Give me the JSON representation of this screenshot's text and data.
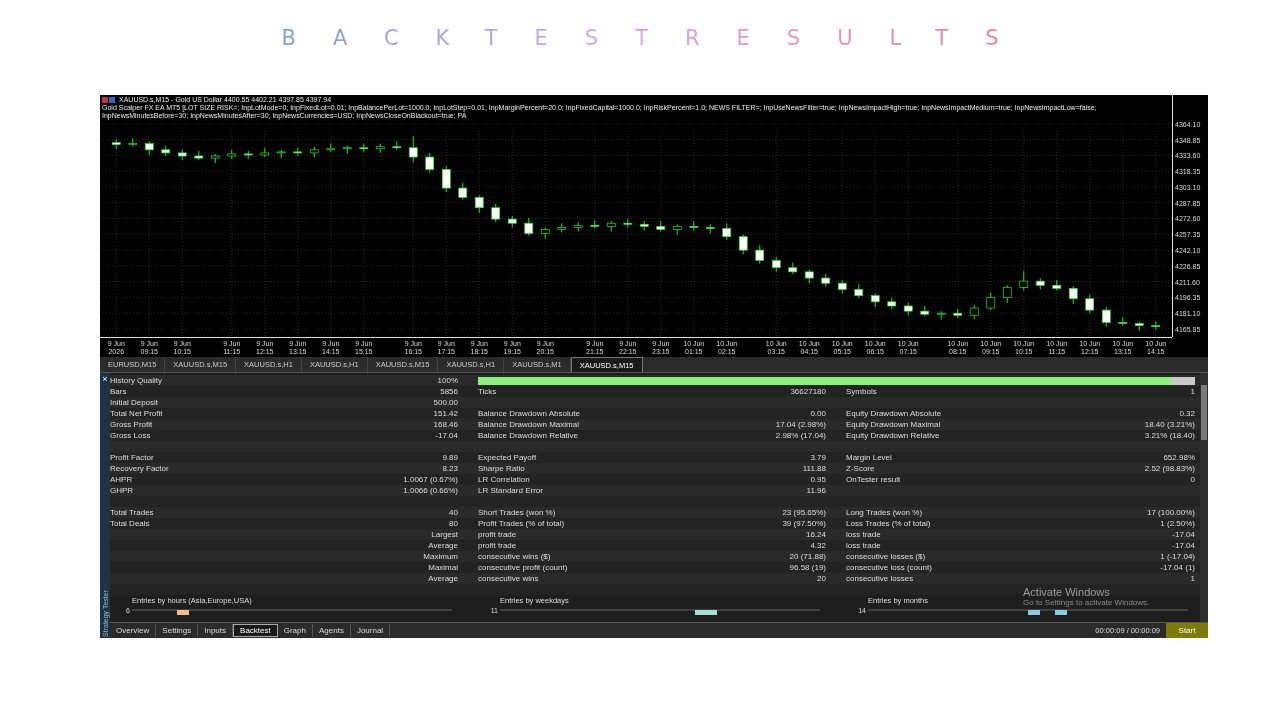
{
  "header": {
    "title": "BACKTESTRESULTS"
  },
  "chart": {
    "title": "XAUUSD.s,M15 - Gold US Dollar 4400.55 4402.21 4397.85 4397.94",
    "parameters": "Gold Scalper FX EA MT5 [LOT SIZE RISK=; InpLotMode=0; InpFixedLot=0.01; InpBalancePerLot=1000.0; InpLotStep=0.01; InpMarginPercent=20.0; InpFixedCapital=1000.0; InpRiskPercent=1.0; NEWS FILTER=; InpUseNewsFilter=true; InpNewsImpactHigh=true; InpNewsImpactMedium=true; InpNewsImpactLow=false; InpNewsMinutesBefore=30; InpNewsMinutesAfter=30; InpNewsCurrencies=USD; InpNewsCloseOnBlackout=true; PA",
    "chart_data": {
      "type": "candlestick",
      "ylim": [
        4158,
        4392
      ],
      "grid": true,
      "categories": [
        "9 Jun 2026",
        null,
        "9 Jun 09:15",
        null,
        "9 Jun 10:15",
        null,
        null,
        "9 Jun 11:15",
        null,
        "9 Jun 12:15",
        null,
        "9 Jun 13:15",
        null,
        "9 Jun 14:15",
        null,
        "9 Jun 15:15",
        null,
        null,
        "9 Jun 16:15",
        null,
        "9 Jun 17:15",
        null,
        "9 Jun 18:15",
        null,
        "9 Jun 19:15",
        null,
        "9 Jun 20:15",
        null,
        null,
        "9 Jun 21:15",
        null,
        "9 Jun 22:15",
        null,
        "9 Jun 23:15",
        null,
        "10 Jun 01:15",
        null,
        "10 Jun 02:15",
        null,
        null,
        "10 Jun 03:15",
        null,
        "10 Jun 04:15",
        null,
        "10 Jun 05:15",
        null,
        "10 Jun 06:15",
        null,
        "10 Jun 07:15",
        null,
        null,
        "10 Jun 08:15",
        null,
        "10 Jun 09:15",
        null,
        "10 Jun 10:15",
        null,
        "10 Jun 11:15",
        null,
        "10 Jun 12:15",
        null,
        "10 Jun 13:15",
        null,
        "10 Jun 14:15"
      ],
      "yticks": [
        {
          "value": 4364.1,
          "label": "4364.10"
        },
        {
          "value": 4348.85,
          "label": "4348.85"
        },
        {
          "value": 4333.6,
          "label": "4333.60"
        },
        {
          "value": 4318.35,
          "label": "4318.35"
        },
        {
          "value": 4303.1,
          "label": "4303.10"
        },
        {
          "value": 4287.85,
          "label": "4287.85"
        },
        {
          "value": 4272.6,
          "label": "4272.60"
        },
        {
          "value": 4257.35,
          "label": "4257.35"
        },
        {
          "value": 4242.1,
          "label": "4242.10"
        },
        {
          "value": 4226.85,
          "label": "4226.85"
        },
        {
          "value": 4211.6,
          "label": "4211.60"
        },
        {
          "value": 4196.35,
          "label": "4196.35"
        },
        {
          "value": 4181.1,
          "label": "4181.10"
        },
        {
          "value": 4165.85,
          "label": "4165.85"
        }
      ],
      "ohlc": [
        [
          4346,
          4349,
          4340,
          4344
        ],
        [
          4344,
          4350,
          4342,
          4345
        ],
        [
          4345,
          4347,
          4334,
          4339
        ],
        [
          4339,
          4343,
          4333,
          4336
        ],
        [
          4336,
          4339,
          4329,
          4333
        ],
        [
          4333,
          4338,
          4329,
          4331
        ],
        [
          4331,
          4335,
          4326,
          4333
        ],
        [
          4333,
          4339,
          4330,
          4335
        ],
        [
          4335,
          4338,
          4330,
          4334
        ],
        [
          4334,
          4341,
          4332,
          4336
        ],
        [
          4336,
          4339,
          4331,
          4337
        ],
        [
          4337,
          4341,
          4333,
          4336
        ],
        [
          4336,
          4342,
          4332,
          4339
        ],
        [
          4339,
          4345,
          4337,
          4340
        ],
        [
          4340,
          4343,
          4335,
          4341
        ],
        [
          4341,
          4345,
          4337,
          4340
        ],
        [
          4340,
          4345,
          4336,
          4342
        ],
        [
          4342,
          4347,
          4339,
          4341
        ],
        [
          4341,
          4352,
          4327,
          4332
        ],
        [
          4332,
          4336,
          4317,
          4320
        ],
        [
          4320,
          4323,
          4298,
          4302
        ],
        [
          4302,
          4307,
          4291,
          4293
        ],
        [
          4293,
          4295,
          4278,
          4283
        ],
        [
          4283,
          4287,
          4269,
          4272
        ],
        [
          4272,
          4275,
          4264,
          4268
        ],
        [
          4268,
          4273,
          4256,
          4258
        ],
        [
          4258,
          4264,
          4253,
          4262
        ],
        [
          4262,
          4268,
          4259,
          4264
        ],
        [
          4264,
          4269,
          4260,
          4266
        ],
        [
          4266,
          4271,
          4263,
          4265
        ],
        [
          4265,
          4270,
          4260,
          4268
        ],
        [
          4268,
          4272,
          4264,
          4267
        ],
        [
          4267,
          4270,
          4261,
          4265
        ],
        [
          4265,
          4270,
          4260,
          4262
        ],
        [
          4262,
          4267,
          4257,
          4265
        ],
        [
          4265,
          4270,
          4261,
          4264
        ],
        [
          4264,
          4267,
          4258,
          4263
        ],
        [
          4263,
          4268,
          4252,
          4255
        ],
        [
          4255,
          4257,
          4238,
          4242
        ],
        [
          4242,
          4247,
          4229,
          4232
        ],
        [
          4232,
          4235,
          4221,
          4225
        ],
        [
          4225,
          4230,
          4219,
          4221
        ],
        [
          4221,
          4223,
          4210,
          4215
        ],
        [
          4215,
          4219,
          4207,
          4210
        ],
        [
          4210,
          4213,
          4200,
          4204
        ],
        [
          4204,
          4209,
          4196,
          4198
        ],
        [
          4198,
          4200,
          4187,
          4192
        ],
        [
          4192,
          4196,
          4185,
          4188
        ],
        [
          4188,
          4191,
          4179,
          4183
        ],
        [
          4183,
          4188,
          4178,
          4180
        ],
        [
          4180,
          4183,
          4175,
          4181
        ],
        [
          4181,
          4185,
          4176,
          4179
        ],
        [
          4179,
          4189,
          4175,
          4186
        ],
        [
          4186,
          4201,
          4184,
          4196
        ],
        [
          4196,
          4208,
          4191,
          4206
        ],
        [
          4206,
          4222,
          4203,
          4212
        ],
        [
          4212,
          4215,
          4204,
          4208
        ],
        [
          4208,
          4213,
          4203,
          4205
        ],
        [
          4205,
          4207,
          4190,
          4195
        ],
        [
          4195,
          4199,
          4181,
          4184
        ],
        [
          4184,
          4187,
          4168,
          4172
        ],
        [
          4172,
          4177,
          4169,
          4171
        ],
        [
          4171,
          4173,
          4164,
          4169
        ],
        [
          4169,
          4173,
          4165,
          4168
        ]
      ]
    }
  },
  "symbol_tabs": [
    {
      "label": "EURUSD,M15",
      "selected": false
    },
    {
      "label": "XAUUSD.s,M15",
      "selected": false
    },
    {
      "label": "XAUUSD.s,H1",
      "selected": false
    },
    {
      "label": "XAUUSD.s,H1",
      "selected": false
    },
    {
      "label": "XAUUSD.s,M15",
      "selected": false
    },
    {
      "label": "XAUUSD.s,H1",
      "selected": false
    },
    {
      "label": "XAUUSD.s,M1",
      "selected": false
    },
    {
      "label": "XAUUSD.s,M15",
      "selected": true
    }
  ],
  "tester": {
    "close": "×",
    "side_label": "Strategy Tester",
    "rows": [
      {
        "kind": "quality",
        "label": "History Quality",
        "value": "100%",
        "level": 0.967
      },
      {
        "kind": "stats",
        "cells": [
          {
            "label": "Bars",
            "value": "5856"
          },
          {
            "label": "Ticks",
            "value": "36627180"
          },
          {
            "label": "Symbols",
            "value": "1"
          }
        ]
      },
      {
        "kind": "stats",
        "cells": [
          {
            "label": "Initial Deposit",
            "value": "500.00"
          }
        ]
      },
      {
        "kind": "stats",
        "cells": [
          {
            "label": "Total Net Profit",
            "value": "151.42"
          },
          {
            "label": "Balance Drawdown Absolute",
            "value": "0.00"
          },
          {
            "label": "Equity Drawdown Absolute",
            "value": "0.32"
          }
        ]
      },
      {
        "kind": "stats",
        "cells": [
          {
            "label": "Gross Profit",
            "value": "168.46"
          },
          {
            "label": "Balance Drawdown Maximal",
            "value": "17.04 (2.98%)"
          },
          {
            "label": "Equity Drawdown Maximal",
            "value": "18.40 (3.21%)"
          }
        ]
      },
      {
        "kind": "stats",
        "cells": [
          {
            "label": "Gross Loss",
            "value": "-17.04"
          },
          {
            "label": "Balance Drawdown Relative",
            "value": "2.98% (17.04)"
          },
          {
            "label": "Equity Drawdown Relative",
            "value": "3.21% (18.40)"
          }
        ]
      },
      {
        "kind": "blank"
      },
      {
        "kind": "stats",
        "cells": [
          {
            "label": "Profit Factor",
            "value": "9.89"
          },
          {
            "label": "Expected Payoff",
            "value": "3.79"
          },
          {
            "label": "Margin Level",
            "value": "652.98%"
          }
        ]
      },
      {
        "kind": "stats",
        "cells": [
          {
            "label": "Recovery Factor",
            "value": "8.23"
          },
          {
            "label": "Sharpe Ratio",
            "value": "111.88"
          },
          {
            "label": "Z-Score",
            "value": "2.52 (98.83%)"
          }
        ]
      },
      {
        "kind": "stats",
        "cells": [
          {
            "label": "AHPR",
            "value": "1.0067 (0.67%)"
          },
          {
            "label": "LR Correlation",
            "value": "0.95"
          },
          {
            "label": "OnTester result",
            "value": "0"
          }
        ]
      },
      {
        "kind": "stats",
        "cells": [
          {
            "label": "GHPR",
            "value": "1.0066 (0.66%)"
          },
          {
            "label": "LR Standard Error",
            "value": "11.96"
          }
        ]
      },
      {
        "kind": "blank"
      },
      {
        "kind": "stats",
        "cells": [
          {
            "label": "Total Trades",
            "value": "40"
          },
          {
            "label": "Short Trades (won %)",
            "value": "23 (95.65%)"
          },
          {
            "label": "Long Trades (won %)",
            "value": "17 (100.00%)"
          }
        ]
      },
      {
        "kind": "stats",
        "cells": [
          {
            "label": "Total Deals",
            "value": "80"
          },
          {
            "label": "Profit Trades (% of total)",
            "value": "39 (97.50%)"
          },
          {
            "label": "Loss Trades (% of total)",
            "value": "1 (2.50%)"
          }
        ]
      },
      {
        "kind": "stats",
        "cells": [
          {
            "value": "Largest"
          },
          {
            "label": "profit trade",
            "value": "16.24"
          },
          {
            "label": "loss trade",
            "value": "-17.04"
          }
        ]
      },
      {
        "kind": "stats",
        "cells": [
          {
            "value": "Average"
          },
          {
            "label": "profit trade",
            "value": "4.32"
          },
          {
            "label": "loss trade",
            "value": "-17.04"
          }
        ]
      },
      {
        "kind": "stats",
        "cells": [
          {
            "value": "Maximum"
          },
          {
            "label": "consecutive wins ($)",
            "value": "20 (71.88)"
          },
          {
            "label": "consecutive losses ($)",
            "value": "1 (-17.04)"
          }
        ]
      },
      {
        "kind": "stats",
        "cells": [
          {
            "value": "Maximal"
          },
          {
            "label": "consecutive profit (count)",
            "value": "96.58 (19)"
          },
          {
            "label": "consecutive loss (count)",
            "value": "-17.04 (1)"
          }
        ]
      },
      {
        "kind": "stats",
        "cells": [
          {
            "value": "Average"
          },
          {
            "label": "consecutive wins",
            "value": "20"
          },
          {
            "label": "consecutive losses",
            "value": "1"
          }
        ]
      },
      {
        "kind": "blank"
      }
    ],
    "entries": [
      {
        "title": "Entries by hours (Asia,Europe,USA)",
        "tick": "6"
      },
      {
        "title": "Entries by weekdays",
        "tick": "11"
      },
      {
        "title": "Entries by months",
        "tick": "14"
      }
    ],
    "tabs": [
      {
        "label": "Overview",
        "selected": false
      },
      {
        "label": "Settings",
        "selected": false
      },
      {
        "label": "Inputs",
        "selected": false
      },
      {
        "label": "Backtest",
        "selected": true
      },
      {
        "label": "Graph",
        "selected": false
      },
      {
        "label": "Agents",
        "selected": false
      },
      {
        "label": "Journal",
        "selected": false
      }
    ],
    "elapsed": "00:00:09 / 00:00:09",
    "start": "Start"
  },
  "os_notice": {
    "title": "Activate Windows",
    "subtitle": "Go to Settings to activate Windows."
  }
}
